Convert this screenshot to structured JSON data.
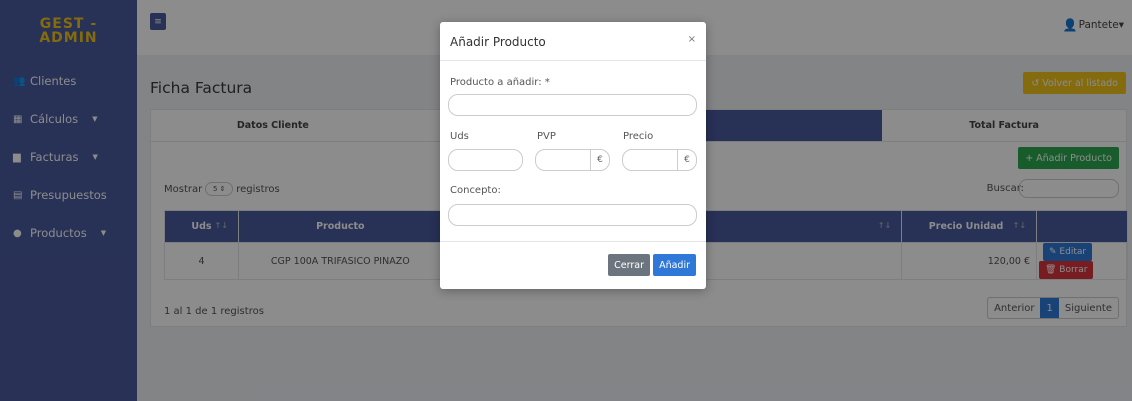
{
  "brand": {
    "line1": "GEST -",
    "line2": "ADMIN"
  },
  "sidebar": {
    "items": [
      {
        "label": "Clientes",
        "icon": "users-icon",
        "glyph": "👥",
        "caret": ""
      },
      {
        "label": "Cálculos",
        "icon": "calculator-icon",
        "glyph": "▦",
        "caret": "▼"
      },
      {
        "label": "Facturas",
        "icon": "file-icon",
        "glyph": "▆",
        "caret": "▼"
      },
      {
        "label": "Presupuestos",
        "icon": "document-icon",
        "glyph": "▤",
        "caret": ""
      },
      {
        "label": "Productos",
        "icon": "product-icon",
        "glyph": "●",
        "caret": "▼"
      }
    ]
  },
  "topbar": {
    "menu_glyph": "≡",
    "user_name": "Pantete",
    "user_glyph": "👤",
    "caret": "▾"
  },
  "page": {
    "title": "Ficha Factura",
    "back_label": "↺ Volver al listado"
  },
  "tabs": [
    "Datos Cliente",
    "",
    "",
    "Total Factura"
  ],
  "toolbar": {
    "add_product_label": "+ Añadir Producto",
    "show_prefix": "Mostrar",
    "show_value": "5 ⇕",
    "show_suffix": "registros",
    "search_label": "Buscar:"
  },
  "table": {
    "headers": {
      "uds": "Uds",
      "producto": "Producto",
      "precio_unidad": "Precio Unidad"
    },
    "sort_glyph": "↑↓",
    "rows": [
      {
        "uds": "4",
        "producto": "CGP 100A TRIFASICO PINAZO",
        "precio_unidad": "120,00 €",
        "edit": "✎ Editar",
        "delete": "🗑 Borrar"
      }
    ]
  },
  "footer": {
    "info": "1 al 1 de 1 registros",
    "prev": "Anterior",
    "page": "1",
    "next": "Siguiente"
  },
  "modal": {
    "title": "Añadir Producto",
    "close_glyph": "×",
    "product_label": "Producto a añadir: *",
    "uds_label": "Uds",
    "pvp_label": "PVP",
    "precio_label": "Precio",
    "currency": "€",
    "concepto_label": "Concepto:",
    "cancel_label": "Cerrar",
    "submit_label": "Añadir"
  },
  "colors": {
    "primary": "#4a5a9d",
    "brand": "#f0c419",
    "success": "#2fa84f",
    "info": "#2f78d8",
    "danger": "#d9363e"
  }
}
